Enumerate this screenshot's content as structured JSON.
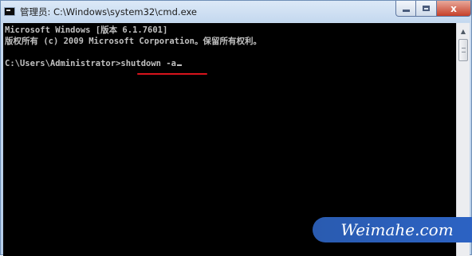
{
  "window": {
    "title": "管理员: C:\\Windows\\system32\\cmd.exe",
    "icon": "cmd-icon",
    "controls": {
      "close_glyph": "x"
    }
  },
  "console": {
    "lines": [
      "Microsoft Windows [版本 6.1.7601]",
      "版权所有 (c) 2009 Microsoft Corporation。保留所有权利。"
    ],
    "prompt": "C:\\Users\\Administrator>",
    "command": "shutdown -a",
    "text_color": "#c0c0c0",
    "background": "#000000",
    "highlight_color": "#d8141c"
  },
  "scrollbar": {
    "up_arrow": "▲"
  },
  "watermark": {
    "text": "Weimahe.com"
  }
}
